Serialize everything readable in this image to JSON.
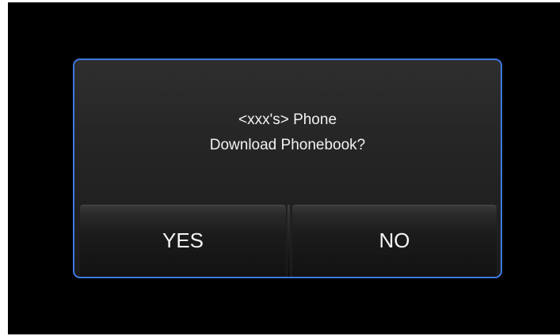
{
  "dialog": {
    "line1": "<xxx's> Phone",
    "line2": "Download Phonebook?",
    "yes_label": "YES",
    "no_label": "NO"
  },
  "colors": {
    "background": "#000000",
    "dialog_border": "#3f78e0",
    "text": "#f2f2f2"
  }
}
